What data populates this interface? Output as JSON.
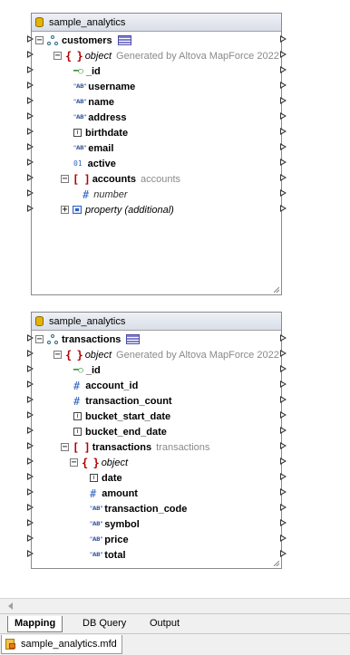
{
  "component1": {
    "title": "sample_analytics",
    "root": "customers",
    "object_label": "object",
    "object_note": "Generated by Altova MapForce 2022",
    "fields": [
      "_id",
      "username",
      "name",
      "address",
      "birthdate",
      "email",
      "active"
    ],
    "array_label": "accounts",
    "array_note": "accounts",
    "array_item": "number",
    "property": "property (additional)"
  },
  "component2": {
    "title": "sample_analytics",
    "root": "transactions",
    "object_label": "object",
    "object_note": "Generated by Altova MapForce 2022",
    "fields": [
      "_id",
      "account_id",
      "transaction_count",
      "bucket_start_date",
      "bucket_end_date"
    ],
    "array_label": "transactions",
    "array_note": "transactions",
    "inner_object": "object",
    "inner_fields": [
      "date",
      "amount",
      "transaction_code",
      "symbol",
      "price",
      "total"
    ]
  },
  "tabs": [
    "Mapping",
    "DB Query",
    "Output"
  ],
  "active_tab": "Mapping",
  "document_tab": "sample_analytics.mfd",
  "icons": {
    "db": "database-icon",
    "hier": "hierarchy-icon",
    "table": "table-icon",
    "doc": "mapforce-file-icon"
  }
}
